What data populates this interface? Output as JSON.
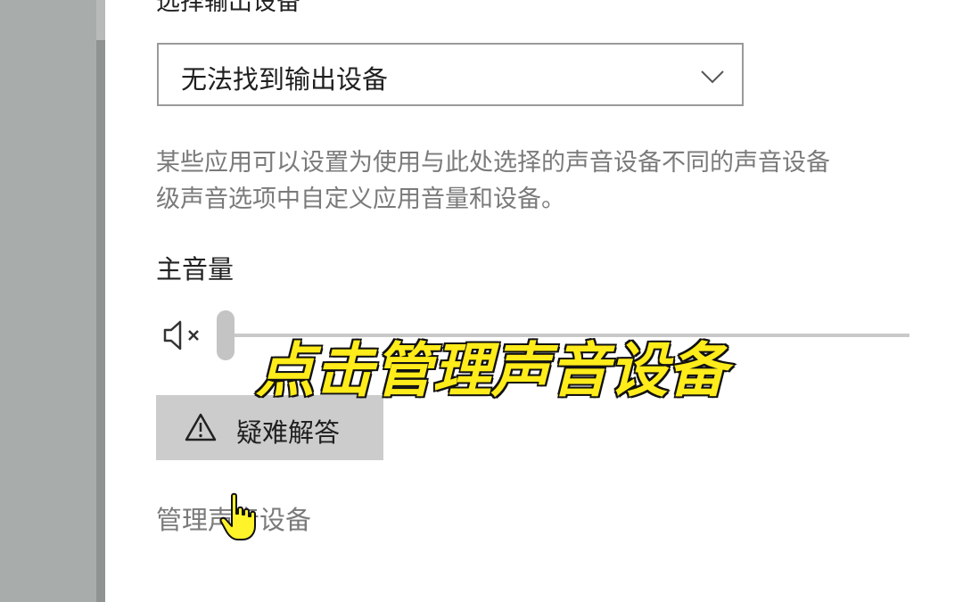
{
  "output": {
    "heading": "选择输出设备",
    "dropdown_value": "无法找到输出设备",
    "description_line1": "某些应用可以设置为使用与此处选择的声音设备不同的声音设备",
    "description_line2": "级声音选项中自定义应用音量和设备。"
  },
  "volume": {
    "heading": "主音量",
    "level": 0,
    "muted": true
  },
  "troubleshoot": {
    "label": "疑难解答"
  },
  "manage": {
    "link_label": "管理声音设备"
  },
  "overlay": {
    "caption": "点击管理声音设备"
  },
  "icons": {
    "dropdown": "chevron-down-icon",
    "mute": "speaker-muted-icon",
    "warning": "warning-triangle-icon",
    "cursor": "hand-cursor-icon"
  },
  "colors": {
    "caption_fill": "#ffec1a",
    "caption_stroke": "#111111",
    "link_text": "#7a7a7a",
    "button_bg": "#cccccc"
  }
}
